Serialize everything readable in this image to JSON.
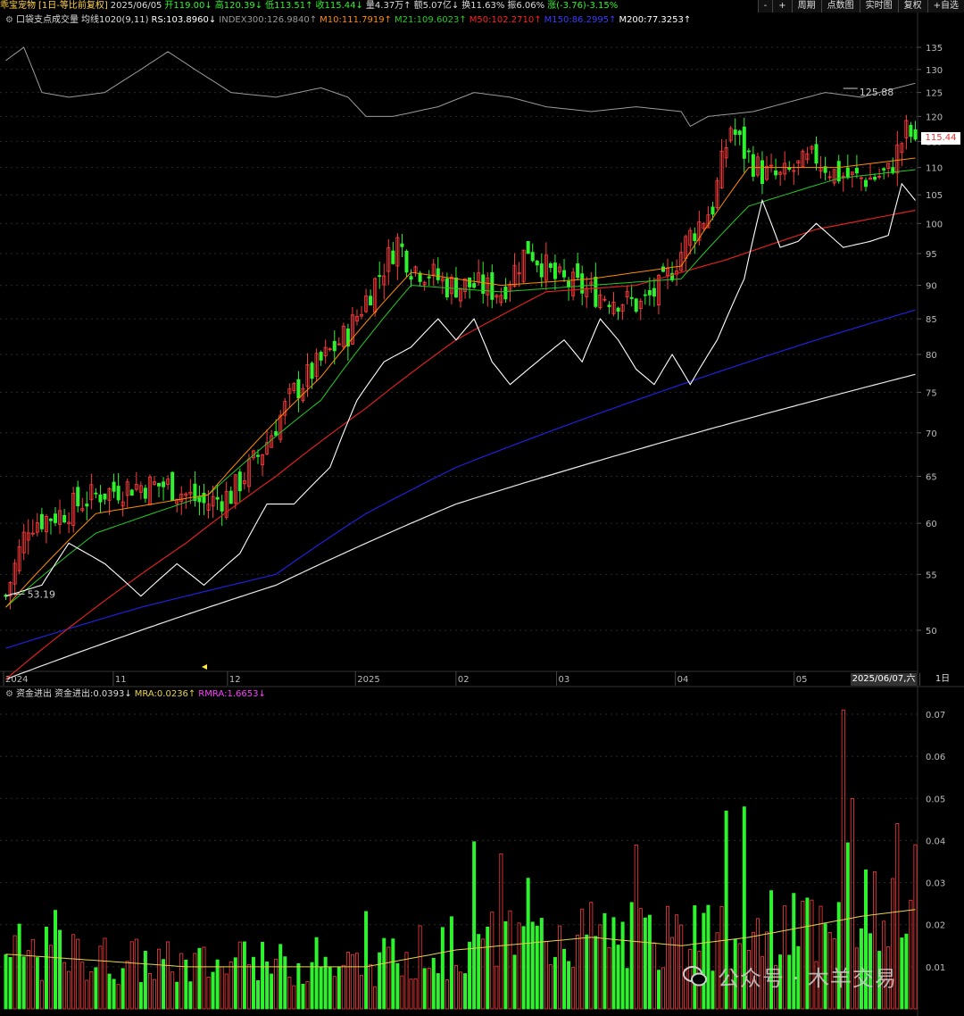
{
  "header": {
    "name": "乖宝宠物",
    "mode": "[1日-等比前复权]",
    "date": "2025/06/05",
    "open": "开119.00↓",
    "high": "高120.39↓",
    "low": "低113.51↑",
    "close": "收115.44↓",
    "volume": "量4.37万↑",
    "amount": "额5.07亿↓",
    "turnover": "换11.63%",
    "amplitude": "振6.06%",
    "change": "涨(-3.76)-3.15%"
  },
  "tabs": [
    "-",
    "+",
    "周期",
    "点数图",
    "实时图",
    "复权",
    "+自选"
  ],
  "legend": {
    "title": "口袋支点成交量",
    "ma": "均线1020(9,11)",
    "rs": "RS:103.8960↓",
    "index": "INDEX300:126.9840↑",
    "m10": "M10:111.7919↑",
    "m21": "M21:109.6023↑",
    "m50": "M50:102.2710↑",
    "m150": "M150:86.2995↑",
    "m200": "M200:77.3253↑"
  },
  "legend2": {
    "title": "资金进出",
    "value": "资金进出:0.0393↓",
    "mra": "MRA:0.0236↑",
    "rmra": "RMRA:1.6653↓"
  },
  "price_tag": "115.44",
  "date_box": "2025/06/07,六",
  "period_button": "1日",
  "annotations": {
    "high_label": "125.88",
    "low_label": "53.19"
  },
  "watermark": "公众号 · 木羊交易",
  "colors": {
    "up": "#ff3c3c",
    "down": "#2ef22e",
    "m10": "#ff8c00",
    "m21": "#22cc22",
    "m50": "#dd2020",
    "m150": "#2020dd",
    "m200": "#e8e8e8",
    "rs": "#ffffff",
    "index": "#9a9a9a",
    "mra": "#e6d34a"
  },
  "chart_data": [
    {
      "type": "candlestick",
      "scale": "log",
      "y_ticks": [
        50,
        55,
        60,
        65,
        70,
        75,
        80,
        85,
        90,
        95,
        100,
        105,
        110,
        115,
        120,
        125,
        130,
        135
      ],
      "x_labels": [
        "2024",
        "11",
        "12",
        "2025",
        "02",
        "03",
        "04",
        "05"
      ],
      "x_label_fractions": [
        0.0,
        0.12,
        0.245,
        0.385,
        0.495,
        0.605,
        0.735,
        0.865
      ],
      "path_keypoints": [
        [
          0,
          53
        ],
        [
          5,
          60
        ],
        [
          12,
          61
        ],
        [
          20,
          63
        ],
        [
          28,
          64
        ],
        [
          36,
          64
        ],
        [
          44,
          62
        ],
        [
          50,
          63
        ],
        [
          57,
          68
        ],
        [
          64,
          75
        ],
        [
          70,
          79
        ],
        [
          76,
          83
        ],
        [
          80,
          88
        ],
        [
          84,
          93
        ],
        [
          87,
          97
        ],
        [
          90,
          93
        ],
        [
          94,
          92
        ],
        [
          98,
          90
        ],
        [
          104,
          90
        ],
        [
          110,
          89
        ],
        [
          116,
          96
        ],
        [
          122,
          91
        ],
        [
          130,
          89
        ],
        [
          136,
          88
        ],
        [
          141,
          87
        ],
        [
          146,
          90
        ],
        [
          152,
          98
        ],
        [
          157,
          103
        ],
        [
          161,
          118
        ],
        [
          164,
          113
        ],
        [
          168,
          109
        ],
        [
          172,
          108
        ],
        [
          176,
          110
        ],
        [
          180,
          112
        ],
        [
          184,
          109
        ],
        [
          188,
          108
        ],
        [
          192,
          108
        ],
        [
          196,
          109
        ],
        [
          200,
          117
        ],
        [
          202,
          115.44
        ]
      ],
      "ma_keypoints": {
        "m10": [
          [
            0,
            52
          ],
          [
            20,
            61
          ],
          [
            45,
            63
          ],
          [
            70,
            77
          ],
          [
            90,
            92
          ],
          [
            110,
            90
          ],
          [
            130,
            91
          ],
          [
            150,
            93
          ],
          [
            165,
            110
          ],
          [
            185,
            110
          ],
          [
            202,
            111.79
          ]
        ],
        "m21": [
          [
            0,
            52
          ],
          [
            20,
            59
          ],
          [
            45,
            63
          ],
          [
            70,
            74
          ],
          [
            90,
            90
          ],
          [
            110,
            89
          ],
          [
            130,
            90
          ],
          [
            150,
            91
          ],
          [
            165,
            103
          ],
          [
            185,
            108
          ],
          [
            202,
            109.6
          ]
        ],
        "m50": [
          [
            0,
            46
          ],
          [
            20,
            52
          ],
          [
            40,
            58
          ],
          [
            60,
            65
          ],
          [
            80,
            73
          ],
          [
            100,
            82
          ],
          [
            120,
            89
          ],
          [
            140,
            90
          ],
          [
            160,
            94
          ],
          [
            180,
            99
          ],
          [
            202,
            102.27
          ]
        ],
        "m150": [
          [
            0,
            48.5
          ],
          [
            30,
            52
          ],
          [
            60,
            55
          ],
          [
            80,
            61
          ],
          [
            100,
            66
          ],
          [
            120,
            70
          ],
          [
            140,
            74
          ],
          [
            160,
            78
          ],
          [
            180,
            82
          ],
          [
            202,
            86.3
          ]
        ],
        "m200": [
          [
            0,
            46
          ],
          [
            30,
            50
          ],
          [
            60,
            54
          ],
          [
            80,
            58
          ],
          [
            100,
            62
          ],
          [
            120,
            65
          ],
          [
            140,
            68
          ],
          [
            160,
            71
          ],
          [
            180,
            74
          ],
          [
            202,
            77.33
          ]
        ],
        "rs": [
          [
            0,
            53
          ],
          [
            8,
            54
          ],
          [
            14,
            58
          ],
          [
            22,
            56
          ],
          [
            30,
            53
          ],
          [
            38,
            56
          ],
          [
            44,
            54
          ],
          [
            52,
            57
          ],
          [
            58,
            62
          ],
          [
            64,
            62
          ],
          [
            72,
            66
          ],
          [
            78,
            74
          ],
          [
            84,
            79
          ],
          [
            90,
            81
          ],
          [
            96,
            85
          ],
          [
            100,
            82
          ],
          [
            104,
            85
          ],
          [
            108,
            79
          ],
          [
            112,
            76
          ],
          [
            118,
            79
          ],
          [
            124,
            82
          ],
          [
            128,
            79
          ],
          [
            132,
            85
          ],
          [
            136,
            82
          ],
          [
            140,
            78
          ],
          [
            144,
            76
          ],
          [
            148,
            80
          ],
          [
            152,
            76
          ],
          [
            158,
            82
          ],
          [
            164,
            91
          ],
          [
            168,
            104
          ],
          [
            172,
            96
          ],
          [
            176,
            97
          ],
          [
            180,
            100
          ],
          [
            186,
            96
          ],
          [
            192,
            97
          ],
          [
            196,
            98
          ],
          [
            199,
            107
          ],
          [
            202,
            104
          ]
        ],
        "index": [
          [
            0,
            132
          ],
          [
            4,
            135
          ],
          [
            8,
            125
          ],
          [
            14,
            124
          ],
          [
            22,
            125
          ],
          [
            30,
            130
          ],
          [
            36,
            134
          ],
          [
            42,
            130
          ],
          [
            50,
            125
          ],
          [
            60,
            124
          ],
          [
            70,
            126
          ],
          [
            76,
            124
          ],
          [
            80,
            120
          ],
          [
            86,
            120
          ],
          [
            96,
            122
          ],
          [
            104,
            125
          ],
          [
            112,
            124
          ],
          [
            120,
            122
          ],
          [
            130,
            121
          ],
          [
            140,
            122
          ],
          [
            150,
            121
          ],
          [
            152,
            118
          ],
          [
            156,
            120
          ],
          [
            166,
            121
          ],
          [
            174,
            123
          ],
          [
            182,
            125
          ],
          [
            190,
            124
          ],
          [
            202,
            127
          ]
        ]
      }
    },
    {
      "type": "bar",
      "title": "资金进出",
      "y_ticks": [
        0.01,
        0.02,
        0.03,
        0.04,
        0.05,
        0.06,
        0.07
      ],
      "ylim": [
        0,
        0.075
      ],
      "highlights": [
        [
          160,
          0.047
        ],
        [
          164,
          0.048
        ],
        [
          186,
          0.071
        ],
        [
          188,
          0.05
        ],
        [
          198,
          0.044
        ],
        [
          202,
          0.039
        ]
      ],
      "baseline_level": 0.012,
      "mra_keypoints": [
        [
          0,
          0.013
        ],
        [
          40,
          0.01
        ],
        [
          80,
          0.01
        ],
        [
          100,
          0.014
        ],
        [
          130,
          0.017
        ],
        [
          150,
          0.015
        ],
        [
          165,
          0.017
        ],
        [
          180,
          0.02
        ],
        [
          190,
          0.022
        ],
        [
          202,
          0.0236
        ]
      ]
    }
  ]
}
